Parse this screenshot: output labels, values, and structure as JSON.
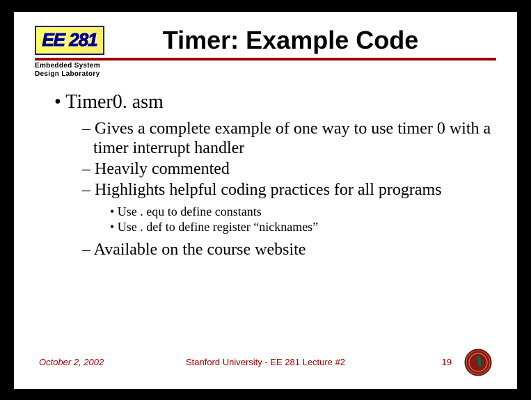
{
  "logo": {
    "text": "EE 281"
  },
  "sublabel": {
    "line1": "Embedded System",
    "line2": "Design Laboratory"
  },
  "title": "Timer: Example Code",
  "bullets": {
    "b1": "• Timer0. asm",
    "b1_1": "– Gives a complete example of one way to use timer 0 with a timer interrupt handler",
    "b1_2": "– Heavily commented",
    "b1_3": "– Highlights helpful coding practices for all programs",
    "b1_3_1": "• Use . equ to define constants",
    "b1_3_2": "• Use . def to define register “nicknames”",
    "b1_4": "– Available on the course website"
  },
  "footer": {
    "date": "October 2, 2002",
    "center": "Stanford University - EE 281 Lecture #2",
    "page": "19"
  }
}
